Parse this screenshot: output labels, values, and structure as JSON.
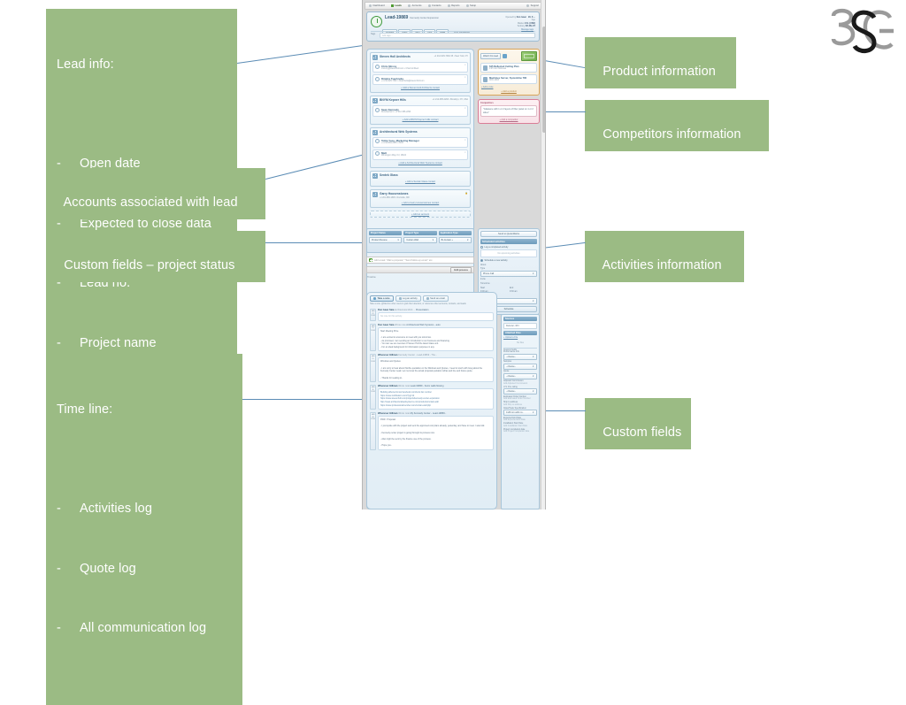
{
  "annotations": {
    "lead_info": {
      "header": "Lead info:",
      "items": [
        "Open date",
        "Expected to close data",
        "Lead no.",
        "Project name"
      ]
    },
    "accounts_associated": "Accounts associated with lead",
    "custom_fields_project_status": "Custom fields – project status",
    "timeline": {
      "header": "Time line:",
      "items": [
        "Activities log",
        "Quote log",
        "All communication log"
      ]
    },
    "product_information": "Product information",
    "competitors_information": "Competitors information",
    "activities_information": "Activities information",
    "custom_fields": "Custom fields"
  },
  "colors": {
    "callout_bg": "#9BBB84",
    "callout_text": "#FFFFFF",
    "leader_line": "#5B8CB5",
    "product_panel_border": "#D9A55A",
    "competitor_panel_border": "#D97D96",
    "section_header": "#6D9BBB"
  },
  "logo": {
    "text": "SGE"
  },
  "app": {
    "nav": [
      {
        "label": "Dashboard",
        "icon": "gauge-icon",
        "active": false
      },
      {
        "label": "Leads",
        "icon": "leads-icon",
        "active": true
      },
      {
        "label": "Accounts",
        "icon": "building-icon",
        "active": false
      },
      {
        "label": "Contacts",
        "icon": "person-icon",
        "active": false
      },
      {
        "label": "Reports",
        "icon": "chart-icon",
        "active": false
      },
      {
        "label": "Setup",
        "icon": "gear-icon",
        "active": false
      },
      {
        "label": "Support",
        "icon": "help-icon",
        "active": false
      }
    ],
    "lead": {
      "title": "Lead-19869",
      "project_name": "Kennedy Center Expansion",
      "stages": [
        "Pending",
        "Open",
        "Won",
        "Lost",
        "Dead"
      ],
      "confidence": "10% confidence",
      "meta": [
        {
          "label": "Opened by",
          "value": "Don Isaac"
        },
        {
          "label": "Age",
          "value": "90, 8 ..."
        },
        {
          "label": "Expected to close",
          "value": "2018"
        },
        {
          "label": "Market",
          "value": "U.S. (USD)"
        },
        {
          "label": "Territory",
          "value": "NY-NV-CT"
        }
      ],
      "tags_label": "Tags",
      "tags_placeholder": "Add tags...",
      "manage_tags": "Manage tags"
    },
    "accounts": [
      {
        "name": "Steven Holl Architects",
        "address": "+1 212-629-7262 45 • New York, NY",
        "contacts": [
          {
            "name": "Chris Mcvoy",
            "role": "",
            "detail": "cmcvoy@stevenholl.com • Chief Architect"
          },
          {
            "name": "Dimitra Tsachrelia",
            "role": "Associate",
            "detail": "+1 212-629-7262 • dtsachrelia@stevenholl.com"
          }
        ],
        "add_link": "+ Add a Steven Holl Architects contact"
      },
      {
        "name": "BNYM Kepner Hills",
        "address": "+1 212-395-2293 • Brooklyn, NY, USA",
        "contacts": [
          {
            "name": "Sean Kennedy",
            "role": "Assistant Principal",
            "detail": "Development • +1 212-395-2293"
          }
        ],
        "add_link": "+ Add a BNYM Kepner Hills contact"
      },
      {
        "name": "Architectural Web Systems",
        "address": "",
        "contacts": [
          {
            "name": "Tolliq Yuce, Marketing Manager",
            "role": "",
            "detail": "+1 212-284-2950 • 8183"
          },
          {
            "name": "Matt",
            "role": "",
            "detail": "Wilmington Way, NJ, 18104"
          }
        ],
        "add_link": "+ Add a Architectural Web Systems contact"
      },
      {
        "name": "Sentek Glass",
        "address": "",
        "contacts": [],
        "add_link": "+ Add a Sentek Glass contact"
      },
      {
        "name": "Garry Housenstones",
        "address": "+1 201-886-1808 • Rockville, MD",
        "contacts": [],
        "add_link": "+ Add a Garry Housenstones contact"
      }
    ],
    "add_account_bar": "+ Add an account",
    "product": {
      "tab_label": "Watch this lead",
      "note_name": "645 Reflected Ceiling Plan",
      "note_sub": "0.25 mm thickness",
      "item_name": "Machines Server, Systemline 780",
      "item_sub": "CNC-1003",
      "add_note": "+ Add a note",
      "add_product": "+ Add a product"
    },
    "competitors": {
      "header": "Competitors",
      "text": "\"Glassene with 1 or 2 layers of fiber panel on 1 or 2 sides\"",
      "add_link": "+ Add a competitor"
    },
    "project_fields": [
      {
        "label": "Project Status",
        "value": "Product Review"
      },
      {
        "label": "Project Type",
        "value": "Curtain Wall"
      },
      {
        "label": "Application Type",
        "value": "Bi-Curtain +"
      }
    ],
    "task": {
      "placeholder": "Add a task: \"Mail a proposal,\" \"Send follow-up email,\" etc.",
      "button": "Edit process"
    },
    "timeline_label": "Timeline",
    "timeline_tabs": [
      {
        "label": "Take a note",
        "icon": "note-icon",
        "active": true
      },
      {
        "label": "Log an activity",
        "icon": "activity-icon",
        "active": false
      },
      {
        "label": "Send an email",
        "icon": "mail-icon",
        "active": false
      }
    ],
    "timeline_hint": "Take a note. @Mention other users to grab their attention, or reference other accounts, contacts, and leads.",
    "timeline_entries": [
      {
        "date_top": "JAN",
        "date_num": "22",
        "date_yr": "2018",
        "head": "Don Isaac Saia",
        "head_sub": "Architectural Web ...",
        "head_tail": "Presentation",
        "body": "No note for this activity.",
        "placeholder": true
      },
      {
        "date_top": "JAN",
        "date_num": "19",
        "date_yr": "2018",
        "head": "Don Isaac Saia",
        "head_sub": "Wrote note",
        "head_tail": "Architectural Web Systems - auto",
        "body": "Start Meeting Price\n\n- I am excited to announce to meet with you tomorrow.\n- As promised, I am sending an introduction to our business and financing.\n- You can see an overview of Steven Holl the latest Glass unit.\n- For an ideal background for information purposes in any.",
        "placeholder": false
      },
      {
        "date_top": "JAN",
        "date_num": "15",
        "date_yr": "2018",
        "head": "Whenever Hillman",
        "head_sub": "Whenever Hillman",
        "head_tail": "Kennedy Center - Lead-19869 - The...",
        "body": "Windows and Quotes\n\n- I am sorry to hear about this/the quotation on the Windows and Quotes, I need to touch with Greg about the Kennedy Center Lead. Let me know the actual proposal quotation is/has and line and future quote.\n\n- Thanks for reading to..",
        "placeholder": false
      },
      {
        "date_top": "JAN",
        "date_num": "11",
        "date_yr": "2018",
        "head": "Whenever Hillman",
        "head_sub": "Wrote note",
        "head_tail": "Lead-19869 - Fenix walls flowing",
        "body": "Building affected know facebook.com/fenix.fan number\nhttps://www.notification.com/?pg=12\nhttps://www.stevenholl.com/projects/kennedy-center-expansion\nhttp://www.architecturalwebsystems.com/products/curtain-wall\nhttps://www.professionalmember.com/curtain-wall.php",
        "placeholder": false
      },
      {
        "date_top": "JAN",
        "date_num": "08",
        "date_yr": "2018",
        "head": "Whenever Hillman",
        "head_sub": "Wrote note",
        "head_tail": "My Kennedy Center - Lead-19869 -",
        "body": "FWD : Proposal\n\n- I just spoke with the project and sent the approved cost plans already, yesterday, and have to meet. I was told.\n\n- Kennedy center project is going through its process now.\n\n- Also might be sent by the finance use of the process.\n\n- Hope you..",
        "placeholder": false
      }
    ],
    "activities_panel": {
      "qw_button": "Send to QuoteWerks",
      "section_header": "Scheduled activities",
      "log_option": "Log a completed activity",
      "empty": "No upcoming activities",
      "schedule_option": "Schedule a new activity",
      "about_label": "About",
      "about_value": "Type",
      "type_value": "Phone Call",
      "invite_label": "Invite",
      "invite_value": "Tomorrow",
      "start_label": "Start",
      "start_value": "9:00 am",
      "end_label": "End",
      "end_value": "9:30 am",
      "all_day_label": "All day, duration",
      "duration_value": "30 m, Phone",
      "schedule_button": "Schedule"
    },
    "right_custom_fields": {
      "sources_header": "Sources",
      "sources_value": "Referral - RFI",
      "files_header": "Attached Files",
      "upload_link": "+ Upload a File",
      "no_files": "No files",
      "custom_header": "Custom Fields",
      "fields": [
        {
          "label": "Performance Info",
          "value": "- choose -",
          "type": "select"
        },
        {
          "label": "Samples",
          "value": "- choose -",
          "type": "select"
        },
        {
          "label": "Quote",
          "value": "- choose -",
          "type": "select"
        },
        {
          "label": "Adjusted Commission",
          "value": "Add Adjusted Commission",
          "type": "ghost"
        },
        {
          "label": "U.S. Fire rating",
          "value": "- choose -",
          "type": "select"
        },
        {
          "label": "Estimated Order Number",
          "value": "Add Estimated Order Number",
          "type": "ghost"
        },
        {
          "label": "Ship to address",
          "value": "Add Ship to address",
          "type": "ghost"
        },
        {
          "label": "GlassTrade Specification",
          "value": "0.28 mm with no..",
          "type": "select"
        },
        {
          "label": "Expected End Date",
          "value": "Add Expected End Date",
          "type": "ghost"
        },
        {
          "label": "Installation Start Date",
          "value": "Add Installation Start Date",
          "type": "ghost"
        },
        {
          "label": "Project completion date",
          "value": "Add Project completion date",
          "type": "ghost"
        }
      ]
    }
  }
}
